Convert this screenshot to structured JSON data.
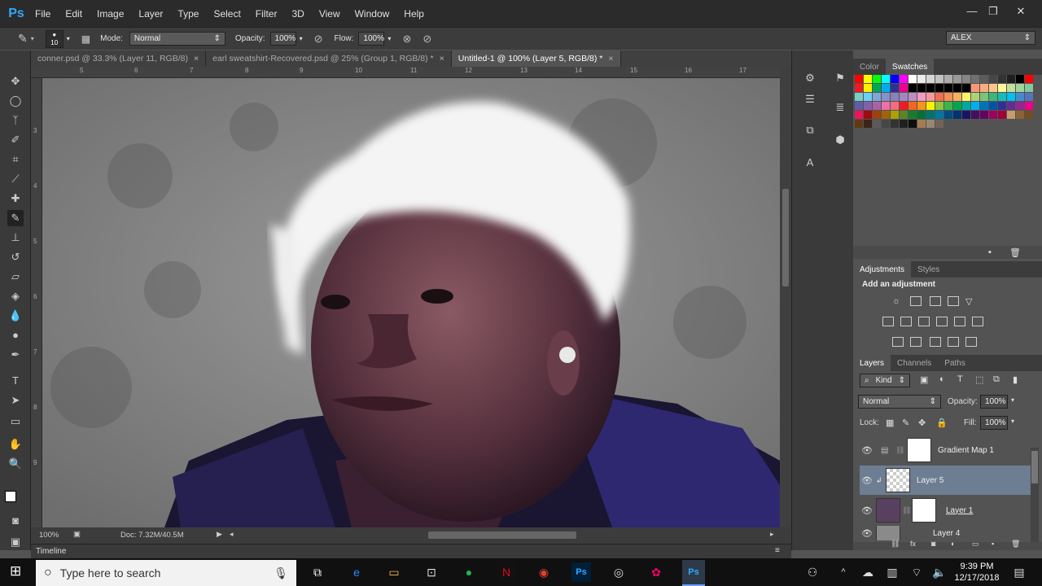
{
  "app": {
    "logo": "Ps"
  },
  "menu": [
    "File",
    "Edit",
    "Image",
    "Layer",
    "Type",
    "Select",
    "Filter",
    "3D",
    "View",
    "Window",
    "Help"
  ],
  "window_controls": {
    "minimize": "—",
    "restore": "❐",
    "close": "✕"
  },
  "options": {
    "brush_size": "10",
    "mode_label": "Mode:",
    "mode_value": "Normal",
    "opacity_label": "Opacity:",
    "opacity_value": "100%",
    "flow_label": "Flow:",
    "flow_value": "100%",
    "workspace": "ALEX"
  },
  "tabs": [
    {
      "label": "conner.psd @ 33.3% (Layer 11, RGB/8)",
      "close": "×"
    },
    {
      "label": "earl sweatshirt-Recovered.psd @ 25% (Group 1, RGB/8) *",
      "close": "×"
    },
    {
      "label": "Untitled-1 @ 100% (Layer 5, RGB/8) *",
      "close": "×"
    }
  ],
  "ruler_top": [
    "5",
    "6",
    "7",
    "8",
    "9",
    "10",
    "11",
    "12",
    "13",
    "14",
    "15",
    "16",
    "17"
  ],
  "ruler_left": [
    "3",
    "4",
    "5",
    "6",
    "7",
    "8",
    "9"
  ],
  "status": {
    "zoom": "100%",
    "doc": "Doc: 7.32M/40.5M"
  },
  "timeline": {
    "label": "Timeline"
  },
  "color_panel": {
    "tabs": [
      "Color",
      "Swatches"
    ]
  },
  "adjustments_panel": {
    "tabs": [
      "Adjustments",
      "Styles"
    ],
    "title": "Add an adjustment"
  },
  "layers_panel": {
    "tabs": [
      "Layers",
      "Channels",
      "Paths"
    ],
    "kind": "Kind",
    "blend": "Normal",
    "opacity_label": "Opacity:",
    "opacity_value": "100%",
    "lock_label": "Lock:",
    "fill_label": "Fill:",
    "fill_value": "100%",
    "layers": [
      {
        "name": "Gradient Map 1",
        "selected": false
      },
      {
        "name": "Layer 5",
        "selected": true
      },
      {
        "name": "Layer 1",
        "selected": false
      },
      {
        "name": "Layer 4",
        "selected": false
      }
    ]
  },
  "taskbar": {
    "search_placeholder": "Type here to search",
    "time": "9:39 PM",
    "date": "12/17/2018"
  },
  "colors": {
    "accent": "#31a8ff",
    "selected_layer": "#6d7d92",
    "taskbar": "#101010"
  }
}
